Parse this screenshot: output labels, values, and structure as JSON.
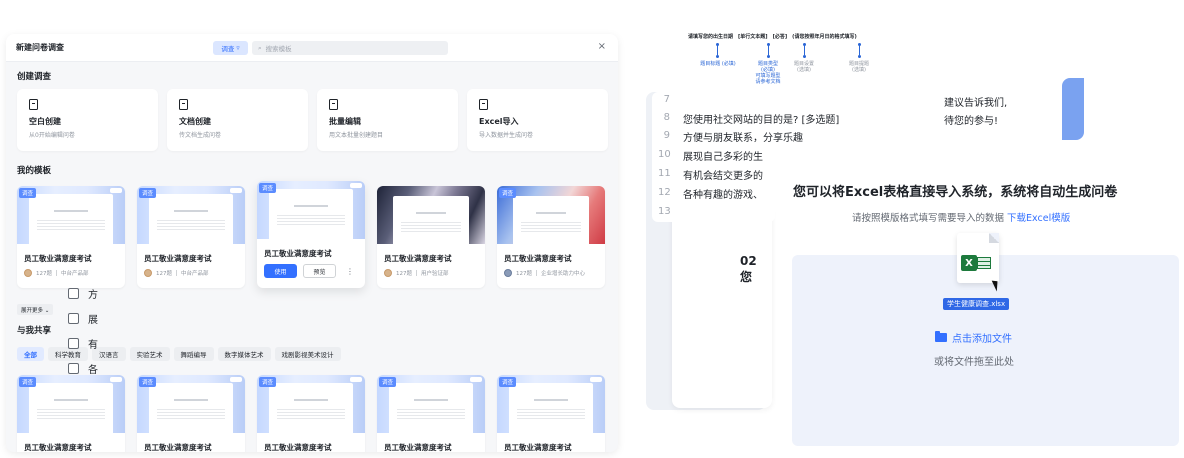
{
  "dialog": {
    "title": "新建问卷调查",
    "type_filter": "调查",
    "search_placeholder": "搜索模板",
    "close": "×"
  },
  "create_section": {
    "title": "创建调查",
    "cards": [
      {
        "name": "空白创建",
        "desc": "从0开始编辑问卷",
        "icon": "blank-doc-icon"
      },
      {
        "name": "文档创建",
        "desc": "传文档生成问卷",
        "icon": "doc-upload-icon"
      },
      {
        "name": "批量编辑",
        "desc": "用文本批量创建题目",
        "icon": "batch-edit-icon"
      },
      {
        "name": "Excel导入",
        "desc": "导入数据并生成问卷",
        "icon": "excel-icon"
      }
    ]
  },
  "my_templates": {
    "title": "我的模板",
    "items": [
      {
        "tag": "调查",
        "name": "员工敬业满意度考试",
        "count": "127题",
        "owner": "中台产品部"
      },
      {
        "tag": "调查",
        "name": "员工敬业满意度考试",
        "count": "127题",
        "owner": "中台产品部"
      },
      {
        "tag": "调查",
        "name": "员工敬业满意度考试",
        "use": "使用",
        "preview": "预览",
        "more": "⋮"
      },
      {
        "tag": "",
        "name": "员工敬业满意度考试",
        "count": "127题",
        "owner": "用户验证部"
      },
      {
        "tag": "调查",
        "name": "员工敬业满意度考试",
        "count": "127题",
        "owner": "企业增长助力中心"
      }
    ],
    "expand": "展开更多 ⌄"
  },
  "shared": {
    "title": "与我共享",
    "filters": [
      "全部",
      "科学教育",
      "汉语言",
      "实验艺术",
      "舞蹈编导",
      "数字媒体艺术",
      "戏剧影视美术设计"
    ],
    "items": [
      {
        "tag": "调查",
        "name": "员工敬业满意度考试"
      },
      {
        "tag": "调查",
        "name": "员工敬业满意度考试"
      },
      {
        "tag": "调查",
        "name": "员工敬业满意度考试"
      },
      {
        "tag": "调查",
        "name": "员工敬业满意度考试"
      },
      {
        "tag": "调查",
        "name": "员工敬业满意度考试"
      }
    ]
  },
  "annotation": {
    "bar": [
      "请填写您的出生日期",
      "[单行文本题]",
      "[必答]",
      "(请您按照年月日的格式填写)"
    ],
    "labels": [
      {
        "text": "题目标题\n(必填)",
        "style": "blue"
      },
      {
        "text": "题目类型\n(必填)\n可填写题型\n请参考文档",
        "style": "blue"
      },
      {
        "text": "题目设置\n(选填)",
        "style": "grey"
      },
      {
        "text": "题目提题\n(选填)",
        "style": "grey"
      }
    ]
  },
  "editor": {
    "line_numbers": [
      "7",
      "8",
      "9",
      "10",
      "11",
      "12",
      "13"
    ],
    "lines": [
      "",
      "您使用社交网站的目的是? [多选题]",
      "方便与朋友联系，分享乐趣",
      "展现自己多彩的生",
      "有机会结交更多的",
      "各种有趣的游戏、",
      ""
    ]
  },
  "doc_preview": {
    "question": "02 您",
    "options": [
      "方",
      "展",
      "有",
      "各"
    ]
  },
  "note": {
    "lines": [
      "建议告诉我们,",
      "待您的参与!"
    ]
  },
  "excel_import": {
    "heading": "您可以将Excel表格直接导入系统，系统将自动生成问卷",
    "sub": "请按照模版格式填写需要导入的数据",
    "link": "下载Excel模版",
    "file_name": "学生健康调查.xlsx",
    "add_file": "点击添加文件",
    "drag_hint": "或将文件拖至此处"
  }
}
